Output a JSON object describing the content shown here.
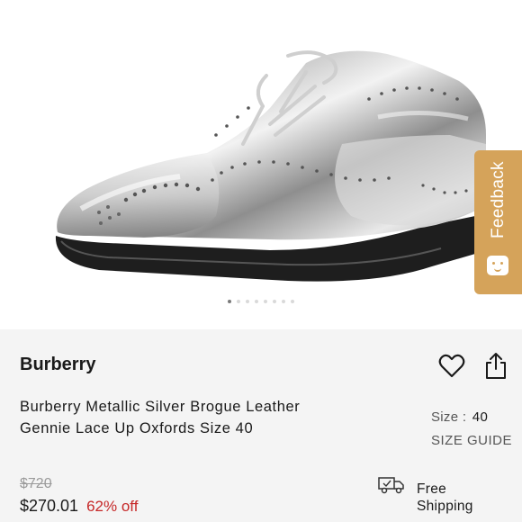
{
  "product_image": {
    "alt": "Burberry Metallic Silver Brogue Leather Gennie Lace Up Oxfords",
    "carousel_count": 8,
    "active_index": 0
  },
  "feedback": {
    "label": "Feedback"
  },
  "product": {
    "brand": "Burberry",
    "title": "Burberry Metallic Silver Brogue Leather Gennie Lace Up Oxfords Size 40",
    "size_label": "Size :",
    "size_value": "40",
    "size_guide": "SIZE GUIDE",
    "original_price": "$720",
    "price": "$270.01",
    "discount": "62% off",
    "shipping": "Free Shipping"
  },
  "icons": {
    "like": "heart-icon",
    "share": "share-icon",
    "shipping": "truck-icon",
    "feedback": "smile-icon"
  },
  "colors": {
    "feedback_tab": "#d5a35a",
    "discount": "#c62828",
    "info_background": "#f4f4f4"
  }
}
